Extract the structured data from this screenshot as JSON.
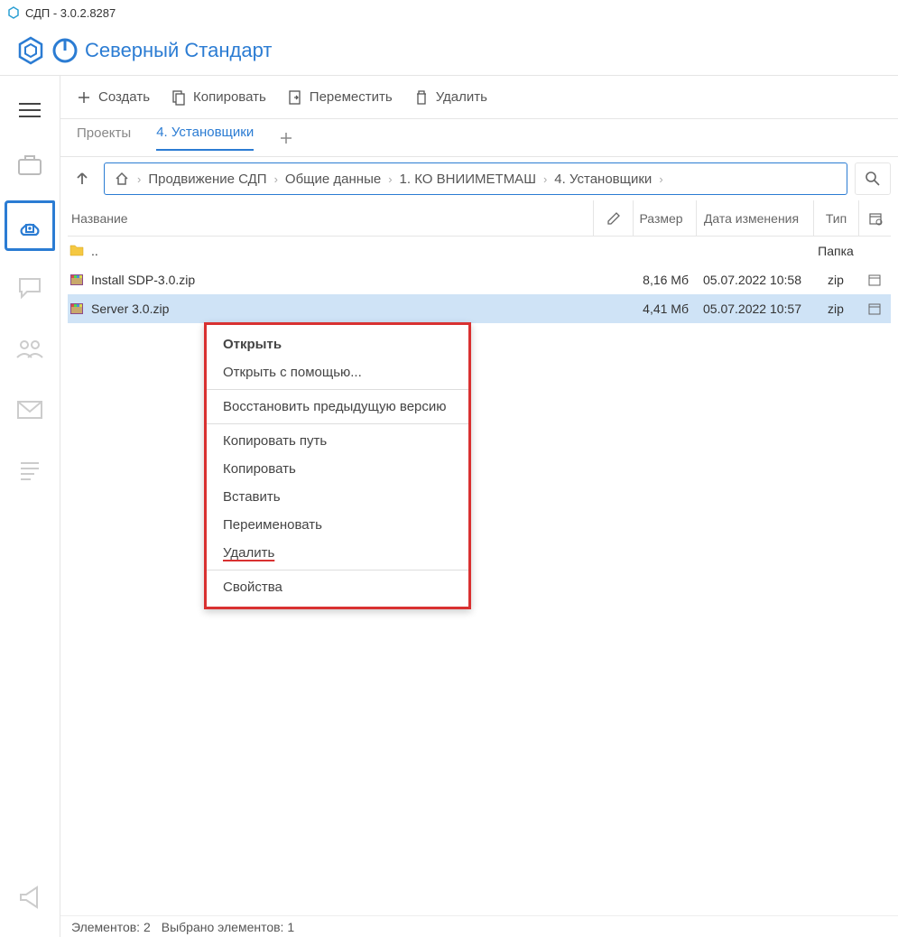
{
  "window": {
    "title": "СДП - 3.0.2.8287"
  },
  "brand": {
    "name": "Северный Стандарт"
  },
  "toolbar": {
    "create": "Создать",
    "copy": "Копировать",
    "move": "Переместить",
    "delete": "Удалить"
  },
  "tabs": {
    "items": [
      {
        "label": "Проекты",
        "active": false
      },
      {
        "label": "4. Установщики",
        "active": true
      }
    ]
  },
  "breadcrumb": {
    "items": [
      "Продвижение СДП",
      "Общие данные",
      "1. КО ВНИИМЕТМАШ",
      "4. Установщики"
    ]
  },
  "columns": {
    "name": "Название",
    "size": "Размер",
    "date": "Дата изменения",
    "type": "Тип"
  },
  "files": {
    "parent": {
      "name": "..",
      "type": "Папка"
    },
    "rows": [
      {
        "name": "Install SDP-3.0.zip",
        "size": "8,16 Мб",
        "date": "05.07.2022 10:58",
        "type": "zip",
        "selected": false
      },
      {
        "name": "Server 3.0.zip",
        "size": "4,41 Мб",
        "date": "05.07.2022 10:57",
        "type": "zip",
        "selected": true
      }
    ]
  },
  "contextMenu": {
    "open": "Открыть",
    "openWith": "Открыть с помощью...",
    "restore": "Восстановить предыдущую версию",
    "copyPath": "Копировать путь",
    "copy": "Копировать",
    "paste": "Вставить",
    "rename": "Переименовать",
    "delete": "Удалить",
    "properties": "Свойства"
  },
  "status": {
    "elements": "Элементов: 2",
    "selected": "Выбрано элементов: 1"
  }
}
